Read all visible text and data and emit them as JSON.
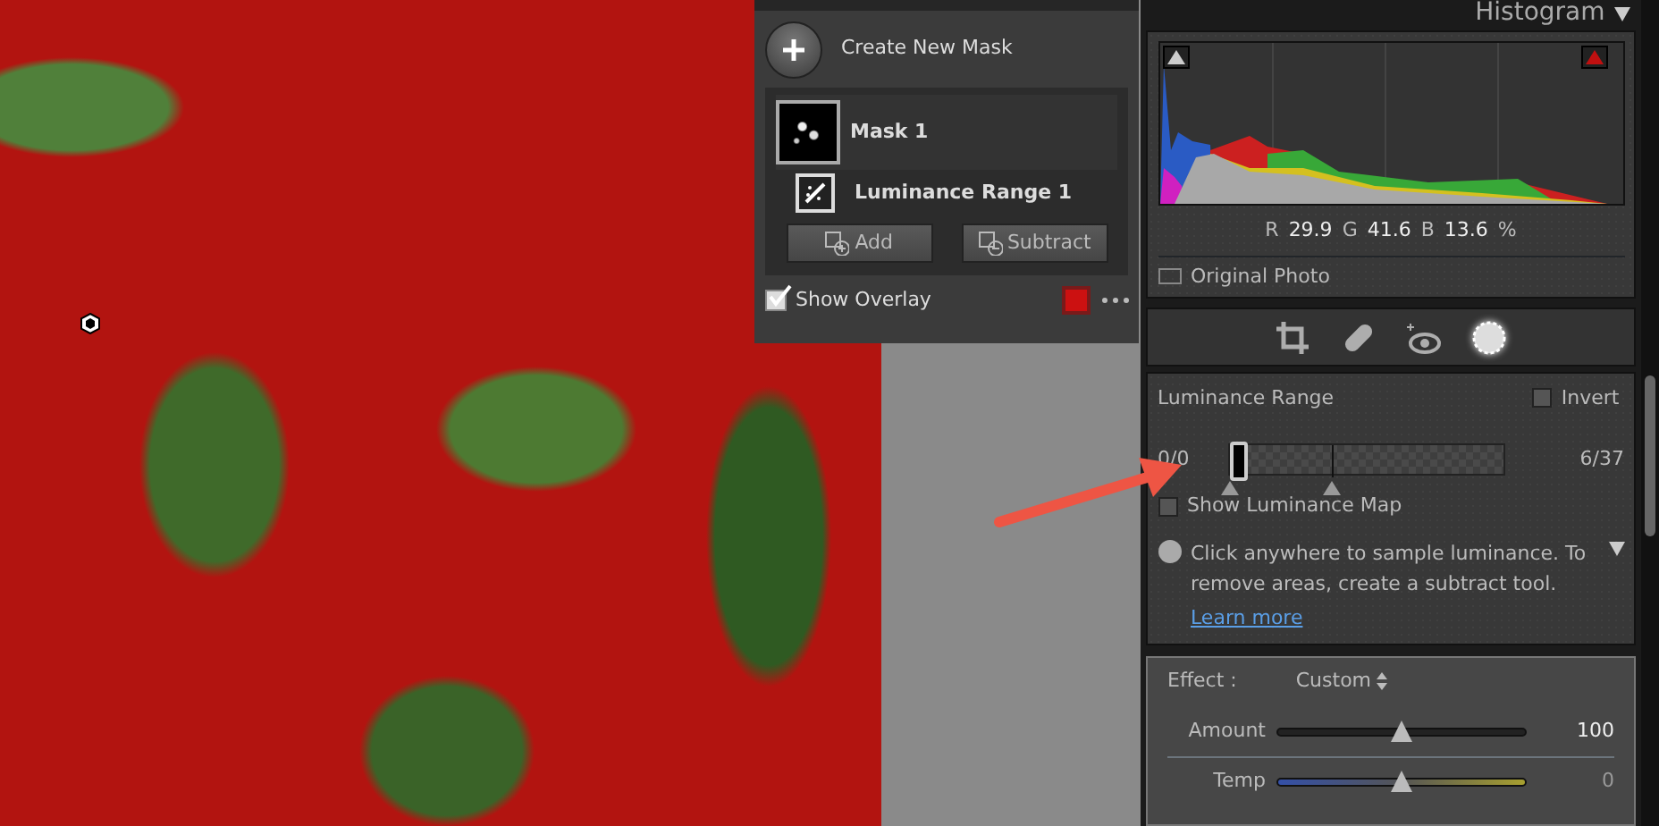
{
  "masks_panel": {
    "create_label": "Create New Mask",
    "masks": [
      {
        "name": "Mask 1",
        "selected": true,
        "components": [
          {
            "name": "Luminance Range 1"
          }
        ]
      }
    ],
    "buttons": [
      {
        "kind": "add",
        "label": "Add"
      },
      {
        "kind": "subtract",
        "label": "Subtract"
      }
    ],
    "overlay": {
      "label": "Show Overlay",
      "checked": true,
      "color": "#cc1111"
    }
  },
  "histogram": {
    "title": "Histogram",
    "readouts": [
      {
        "channel": "R",
        "value": "29.9"
      },
      {
        "channel": "G",
        "value": "41.6"
      },
      {
        "channel": "B",
        "value": "13.6"
      }
    ],
    "unit": "%",
    "original_photo": {
      "label": "Original Photo",
      "checked": false
    }
  },
  "tools": [
    {
      "kind": "crop",
      "selected": false
    },
    {
      "kind": "heal",
      "selected": false
    },
    {
      "kind": "redeye",
      "selected": false
    },
    {
      "kind": "mask",
      "selected": true
    }
  ],
  "luminance": {
    "title": "Luminance Range",
    "invert": {
      "label": "Invert",
      "checked": false
    },
    "min_label": "0/0",
    "max_label": "6/37",
    "handles": [
      {
        "level": 0.0
      },
      {
        "level": 0.37
      }
    ],
    "show_map": {
      "label": "Show Luminance Map",
      "checked": false
    },
    "info": "Click anywhere to sample luminance. To remove areas, create a subtract tool.",
    "link": "Learn more"
  },
  "effect": {
    "label": "Effect :",
    "value": "Custom",
    "sliders": [
      {
        "name": "Amount",
        "kind": "plain",
        "level": 0.5,
        "reading": "100"
      },
      {
        "name": "Temp",
        "kind": "temp",
        "level": 0.5,
        "reading": "0"
      }
    ]
  }
}
